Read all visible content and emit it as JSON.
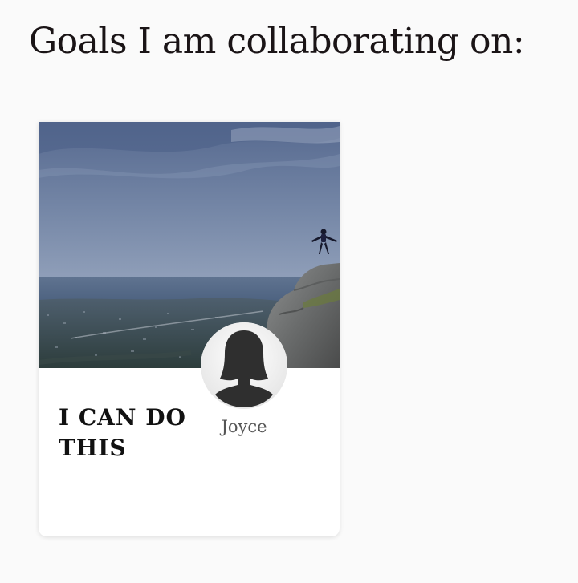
{
  "page": {
    "heading": "Goals I am collaborating on:"
  },
  "goal_card": {
    "title": "I CAN DO THIS",
    "image_icon": "mountain-summit-photo",
    "collaborator": {
      "name": "Joyce",
      "avatar_icon": "female-silhouette-avatar"
    }
  },
  "colors": {
    "background": "#fafafa",
    "heading_text": "#1a1416",
    "card_background": "#ffffff",
    "title_text": "#111111",
    "name_text": "#555555"
  }
}
